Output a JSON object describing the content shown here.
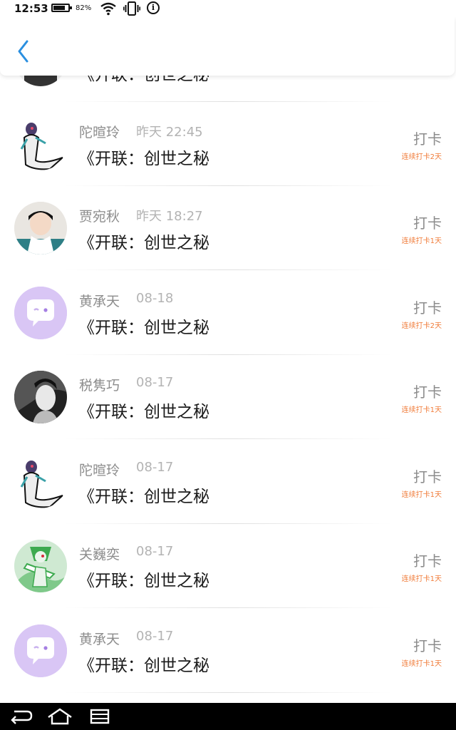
{
  "status_bar": {
    "time": "12:53",
    "battery_percent": "82%",
    "battery_level": 0.82
  },
  "header": {
    "back_icon": "chevron-left-icon",
    "accent_color": "#2a8fe0"
  },
  "checkins": [
    {
      "user": "",
      "time": "",
      "title": "《开联：创世之秘",
      "action": "",
      "streak": "",
      "avatar": "dark-portrait"
    },
    {
      "user": "陀暄玲",
      "time": "昨天 22:45",
      "title": "《开联：创世之秘",
      "action": "打卡",
      "streak": "连续打卡2天",
      "avatar": "gardevoir-dark"
    },
    {
      "user": "贾宛秋",
      "time": "昨天 18:27",
      "title": "《开联：创世之秘",
      "action": "打卡",
      "streak": "连续打卡1天",
      "avatar": "girl-photo"
    },
    {
      "user": "黄承天",
      "time": "08-18",
      "title": "《开联：创世之秘",
      "action": "打卡",
      "streak": "连续打卡2天",
      "avatar": "default-chat"
    },
    {
      "user": "税隽巧",
      "time": "08-17",
      "title": "《开联：创世之秘",
      "action": "打卡",
      "streak": "连续打卡1天",
      "avatar": "bw-portrait"
    },
    {
      "user": "陀暄玲",
      "time": "08-17",
      "title": "《开联：创世之秘",
      "action": "打卡",
      "streak": "连续打卡1天",
      "avatar": "gardevoir-dark"
    },
    {
      "user": "关巍奕",
      "time": "08-17",
      "title": "《开联：创世之秘",
      "action": "打卡",
      "streak": "连续打卡1天",
      "avatar": "gallade-green"
    },
    {
      "user": "黄承天",
      "time": "08-17",
      "title": "《开联：创世之秘",
      "action": "打卡",
      "streak": "连续打卡1天",
      "avatar": "default-chat"
    }
  ],
  "colors": {
    "streak": "#f07c3a",
    "name": "#8c8c8c",
    "title": "#1a1a1a",
    "default_avatar_bg": "#d9c6f5"
  },
  "nav_bar": {
    "icons": [
      "back-icon",
      "home-icon",
      "recent-apps-icon"
    ]
  }
}
